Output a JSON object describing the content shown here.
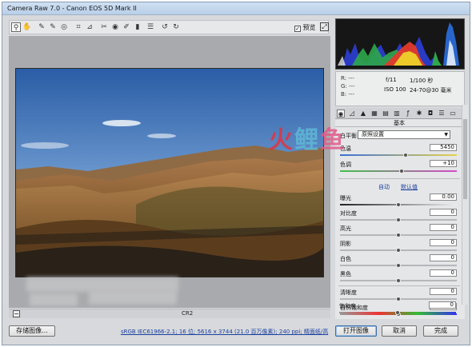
{
  "window": {
    "title": "Camera Raw 7.0 - Canon EOS 5D Mark II"
  },
  "toolbar": {
    "tools": [
      {
        "name": "zoom-tool-icon",
        "glyph": "⚲"
      },
      {
        "name": "hand-tool-icon",
        "glyph": "✋"
      },
      {
        "name": "white-balance-tool-icon",
        "glyph": "✎"
      },
      {
        "name": "color-sampler-tool-icon",
        "glyph": "✎"
      },
      {
        "name": "targeted-adjustment-tool-icon",
        "glyph": "◎"
      },
      {
        "name": "crop-tool-icon",
        "glyph": "⌗"
      },
      {
        "name": "straighten-tool-icon",
        "glyph": "⊿"
      },
      {
        "name": "spot-removal-tool-icon",
        "glyph": "✂"
      },
      {
        "name": "red-eye-tool-icon",
        "glyph": "◉"
      },
      {
        "name": "adjustment-brush-icon",
        "glyph": "✐"
      },
      {
        "name": "graduated-filter-icon",
        "glyph": "▮"
      },
      {
        "name": "preferences-icon",
        "glyph": "☰"
      },
      {
        "name": "rotate-ccw-icon",
        "glyph": "↺"
      },
      {
        "name": "rotate-cw-icon",
        "glyph": "↻"
      }
    ],
    "preview_label": "预览",
    "preview_checked": "✓"
  },
  "status": {
    "zoom_minus": "−",
    "filename": "CR2"
  },
  "bottom": {
    "save_label": "存储图像...",
    "info_link": "sRGB IEC61966-2.1; 16 位; 5616 x 3744 (21.0 百万像素); 240 ppi; 精面纸/高",
    "open_label": "打开图像",
    "cancel_label": "取消",
    "done_label": "完成"
  },
  "readout": {
    "r": "R:  ---",
    "g": "G:  ---",
    "b": "B:  ---",
    "aperture": "f/11",
    "shutter": "1/100 秒",
    "iso": "ISO 100",
    "focal": "24-70@30 毫米"
  },
  "panel": {
    "header": "基本",
    "wb_label": "白平衡:",
    "wb_value": "原照设置",
    "auto_label": "自动",
    "default_label": "默认值",
    "sliders": {
      "temperature": {
        "label": "色温",
        "value": "5450",
        "position": 0.56
      },
      "tint": {
        "label": "色调",
        "value": "+10",
        "position": 0.53
      },
      "exposure": {
        "label": "曝光",
        "value": "0.00",
        "position": 0.5
      },
      "contrast": {
        "label": "对比度",
        "value": "0",
        "position": 0.5
      },
      "highlights": {
        "label": "高光",
        "value": "0",
        "position": 0.5
      },
      "shadows": {
        "label": "阴影",
        "value": "0",
        "position": 0.5
      },
      "whites": {
        "label": "白色",
        "value": "0",
        "position": 0.5
      },
      "blacks": {
        "label": "黑色",
        "value": "0",
        "position": 0.5
      },
      "clarity": {
        "label": "清晰度",
        "value": "0",
        "position": 0.5
      },
      "vibrance": {
        "label": "自然饱和度",
        "value": "0",
        "position": 0.5
      },
      "saturation": {
        "label": "饱和度",
        "value": "0",
        "position": 0.5
      }
    }
  },
  "watermark": {
    "part1": "火",
    "part2": "鲤",
    "part3": "鱼"
  }
}
